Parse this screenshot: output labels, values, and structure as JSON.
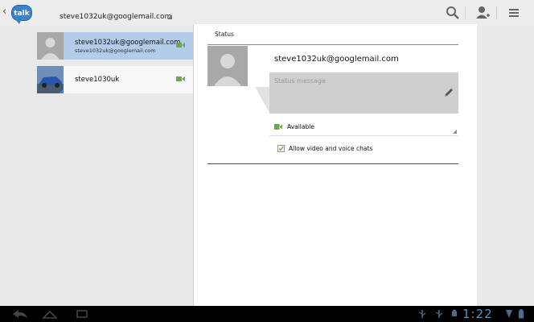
{
  "app": {
    "account_email": "steve1032uk@googlemail.com",
    "icon_text": "talk",
    "icons": [
      "back-chevron-icon",
      "talk-app-icon",
      "search-icon",
      "add-contact-icon",
      "menu-icon"
    ]
  },
  "contacts": [
    {
      "name": "steve1032uk@googlemail.com",
      "subtitle": "steve1032uk@googlemail.com",
      "selected": true,
      "presence": "video"
    },
    {
      "name": "steve1030uk",
      "subtitle": "",
      "selected": false,
      "presence": "video"
    }
  ],
  "detail": {
    "header": "Status",
    "email": "steve1032uk@googlemail.com",
    "status_placeholder": "Status message",
    "availability": "Available",
    "allow_chats_label": "Allow video and voice chats",
    "allow_chats_checked": true
  },
  "system_bar": {
    "clock": "1:22"
  },
  "colors": {
    "selected_row": "#b3ccea",
    "presence_green": "#6aa84f",
    "clock_blue": "#5f8fc2"
  }
}
